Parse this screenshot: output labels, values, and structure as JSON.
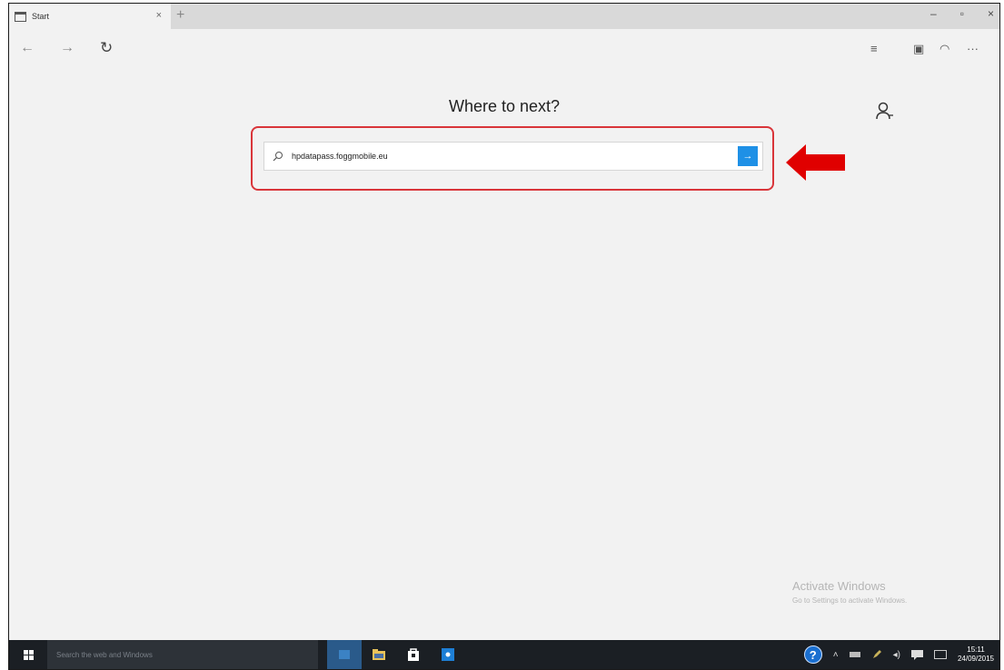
{
  "tab": {
    "title": "Start",
    "close_glyph": "×",
    "new_tab_glyph": "+"
  },
  "window_controls": {
    "minimize": "–",
    "restore": "▫",
    "close": "×"
  },
  "nav": {
    "back": "←",
    "forward": "→",
    "refresh": "↻"
  },
  "toolbar": {
    "hub": "≡",
    "note": "▣",
    "share": "◠",
    "more": "···"
  },
  "main": {
    "heading": "Where to next?",
    "search_value": "hpdatapass.foggmobile.eu",
    "go_glyph": "→"
  },
  "watermark": {
    "title": "Activate Windows",
    "subtitle": "Go to Settings to activate Windows."
  },
  "taskbar": {
    "search_placeholder": "Search the web and Windows",
    "clock_time": "15:11",
    "clock_date": "24/09/2015"
  },
  "colors": {
    "accent": "#1e90e6",
    "highlight_border": "#d9353a",
    "annotation_arrow": "#e00000",
    "taskbar": "#1b1f24"
  },
  "icons": [
    "tab-page-icon",
    "search-icon",
    "go-arrow-icon",
    "person-icon",
    "help-icon",
    "windows-logo-icon"
  ]
}
